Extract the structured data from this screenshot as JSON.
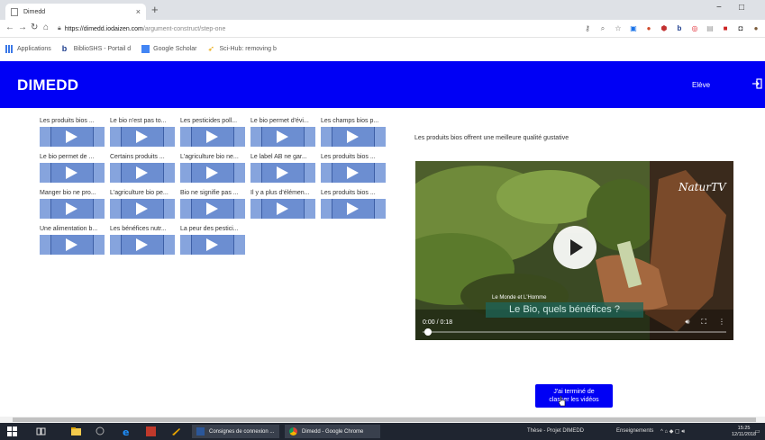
{
  "browser": {
    "tab_title": "Dimedd",
    "tab_close": "×",
    "new_tab": "+",
    "win_min": "−",
    "win_max": "□",
    "url_host": "https://dimedd.iodaizen.com",
    "url_path": "/argument-construct/step-one",
    "bookmarks": [
      {
        "label": "Applications"
      },
      {
        "label": "BiblioSHS - Portail d"
      },
      {
        "label": "Google Scholar"
      },
      {
        "label": "Sci-Hub: removing b"
      }
    ]
  },
  "app": {
    "brand": "DIMEDD",
    "role": "Elève"
  },
  "videos": [
    [
      "Les produits bios ...",
      "Le bio n'est pas to...",
      "Les pesticides poll...",
      "Le bio permet d'évi...",
      "Les champs bios p..."
    ],
    [
      "Le bio permet de ...",
      "Certains produits ...",
      "L'agriculture bio ne...",
      "Le label AB ne gar...",
      "Les produits bios ..."
    ],
    [
      "Manger bio ne pro...",
      "L'agriculture bio pe...",
      "Bio ne signifie pas ...",
      "Il y a plus d'élémen...",
      "Les produits bios ..."
    ],
    [
      "Une alimentation b...",
      "Les bénéfices nutr...",
      "La peur des pestici..."
    ]
  ],
  "player": {
    "caption": "Les produits bios offrent une meilleure qualité gustative",
    "watermark": "NaturTV",
    "show_name": "Le Monde et L'Homme",
    "episode_title": "Le Bio, quels bénéfices ?",
    "time": "0:00 / 0:18",
    "progress_fraction": 0.0
  },
  "done_button": {
    "line1": "J'ai terminé de",
    "line2": "classer les vidéos"
  },
  "taskbar": {
    "apps": [
      "Consignes de connexion ...",
      "Dimedd - Google Chrome"
    ],
    "tray_left": "Thèse - Projet DIMEDD",
    "tray_right": "Enseignements",
    "time": "15:25",
    "date": "12/11/2018"
  },
  "colors": {
    "brand_blue": "#0000f5",
    "thumb_blue": "#6c8ed1"
  }
}
